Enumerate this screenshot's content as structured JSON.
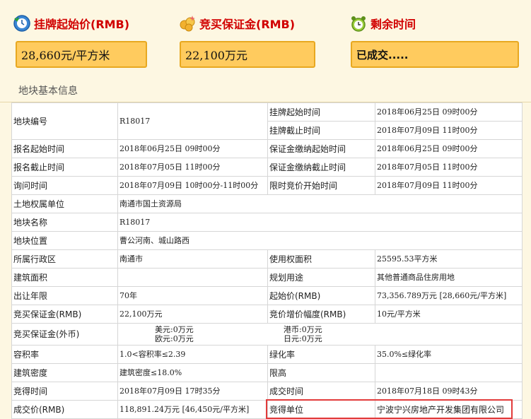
{
  "header": {
    "start_price": {
      "title": "挂牌起始价(RMB)",
      "value": "28,660元/平方米",
      "icon": "clock-refresh-icon"
    },
    "deposit": {
      "title": "竞买保证金(RMB)",
      "value": "22,100万元",
      "icon": "money-coins-icon"
    },
    "remaining": {
      "title": "剩余时间",
      "value": "已成交.....",
      "icon": "alarm-clock-icon"
    }
  },
  "section_title": "地块基本信息",
  "rows": {
    "r1": {
      "l1": "地块编号",
      "v1": "R18017",
      "l2": "挂牌起始时间",
      "v2": "2018年06月25日 09时00分"
    },
    "r1b": {
      "l2": "挂牌截止时间",
      "v2": "2018年07月09日 11时00分"
    },
    "r2": {
      "l1": "报名起始时间",
      "v1": "2018年06月25日 09时00分",
      "l2": "保证金缴纳起始时间",
      "v2": "2018年06月25日 09时00分"
    },
    "r3": {
      "l1": "报名截止时间",
      "v1": "2018年07月05日 11时00分",
      "l2": "保证金缴纳截止时间",
      "v2": "2018年07月05日 11时00分"
    },
    "r4": {
      "l1": "询问时间",
      "v1": "2018年07月09日 10时00分-11时00分",
      "l2": "限时竞价开始时间",
      "v2": "2018年07月09日 11时00分"
    },
    "r5": {
      "l1": "土地权属单位",
      "v1": "南通市国土资源局"
    },
    "r6": {
      "l1": "地块名称",
      "v1": "R18017"
    },
    "r7": {
      "l1": "地块位置",
      "v1": "曹公河南、城山路西"
    },
    "r8": {
      "l1": "所属行政区",
      "v1": "南通市",
      "l2": "使用权面积",
      "v2": "25595.53平方米"
    },
    "r9": {
      "l1": "建筑面积",
      "v1": "",
      "l2": "规划用途",
      "v2": "其他普通商品住房用地"
    },
    "r10": {
      "l1": "出让年限",
      "v1": "70年",
      "l2": "起始价(RMB)",
      "v2": "73,356.789万元 [28,660元/平方米]"
    },
    "r11": {
      "l1": "竞买保证金(RMB)",
      "v1": "22,100万元",
      "l2": "竞价增价幅度(RMB)",
      "v2": "10元/平方米"
    },
    "r12": {
      "l1": "竞买保证金(外币)",
      "usd": "美元:0万元",
      "eur": "欧元:0万元",
      "hkd": "港币:0万元",
      "jpy": "日元:0万元"
    },
    "r13": {
      "l1": "容积率",
      "v1": "1.0<容积率≤2.39",
      "l2": "绿化率",
      "v2": "35.0%≤绿化率"
    },
    "r14": {
      "l1": "建筑密度",
      "v1": "建筑密度≤18.0%",
      "l2": "限高",
      "v2": ""
    },
    "r15": {
      "l1": "竞得时间",
      "v1": "2018年07月09日 17时35分",
      "l2": "成交时间",
      "v2": "2018年07月18日 09时43分"
    },
    "r16": {
      "l1": "成交价(RMB)",
      "v1": "118,891.24万元 [46,450元/平方米]",
      "l2": "竞得单位",
      "v2": "宁波宁兴房地产开发集团有限公司"
    }
  },
  "colors": {
    "accent_red": "#d10000",
    "box_fill": "#ffcb5e",
    "highlight": "#e23b3b"
  }
}
